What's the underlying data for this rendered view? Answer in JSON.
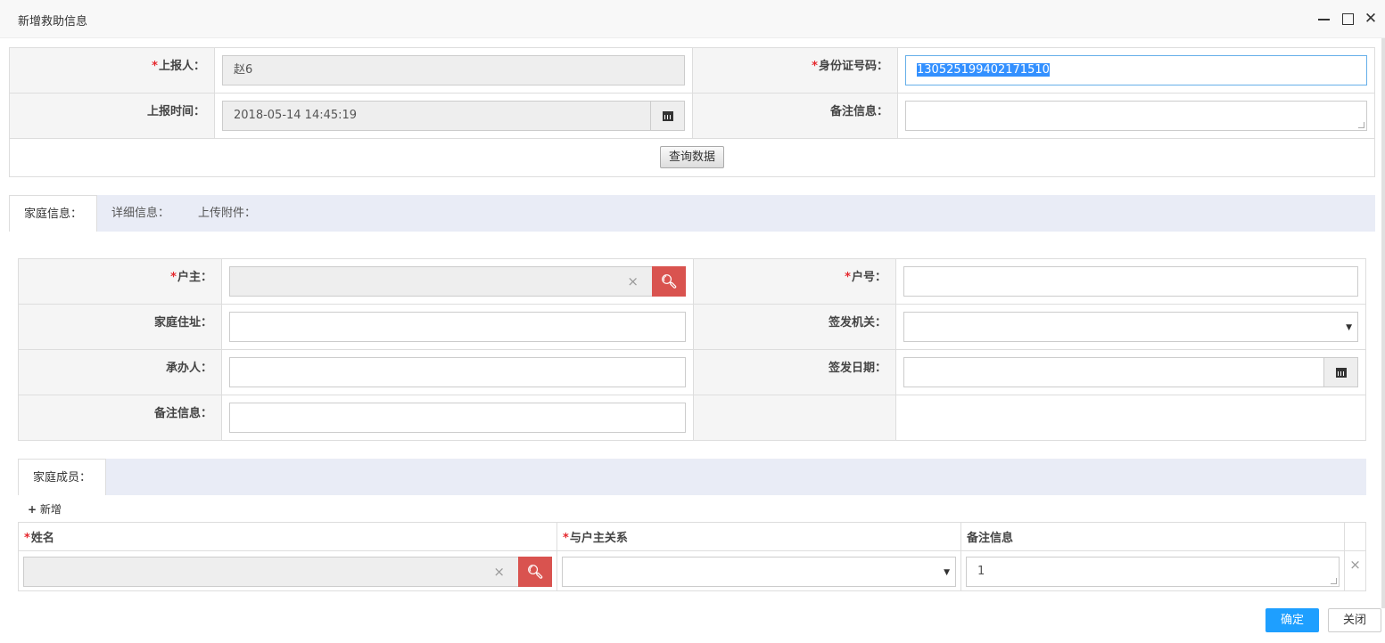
{
  "dialog": {
    "title": "新增救助信息",
    "confirm_label": "确定",
    "close_label": "关闭"
  },
  "report": {
    "reporter_label": "上报人：",
    "reporter_value": "赵6",
    "id_label": "身份证号码：",
    "id_value": "130525199402171510",
    "time_label": "上报时间：",
    "time_value": "2018-05-14 14:45:19",
    "remark_label": "备注信息：",
    "remark_value": "",
    "query_button": "查询数据"
  },
  "tabs": [
    {
      "label": "家庭信息：",
      "active": true
    },
    {
      "label": "详细信息：",
      "active": false
    },
    {
      "label": "上传附件：",
      "active": false
    }
  ],
  "family": {
    "householder_label": "户主：",
    "householder_value": "",
    "household_no_label": "户号：",
    "household_no_value": "",
    "address_label": "家庭住址：",
    "address_value": "",
    "authority_label": "签发机关：",
    "authority_value": "",
    "handler_label": "承办人：",
    "handler_value": "",
    "issue_date_label": "签发日期：",
    "issue_date_value": "",
    "remark_label": "备注信息：",
    "remark_value": ""
  },
  "members": {
    "tab_label": "家庭成员：",
    "add_label": "新增",
    "columns": [
      "姓名",
      "与户主关系",
      "备注信息"
    ],
    "rows": [
      {
        "name": "",
        "relation": "",
        "remark": "1"
      }
    ]
  },
  "icons": {
    "required_mark": "*",
    "clear": "×",
    "search": "search-icon",
    "calendar": "calendar-icon"
  },
  "colors": {
    "required": "#e5272d",
    "search_button": "#d9534f",
    "primary_button": "#1e9fff",
    "selection": "#3390ff"
  }
}
